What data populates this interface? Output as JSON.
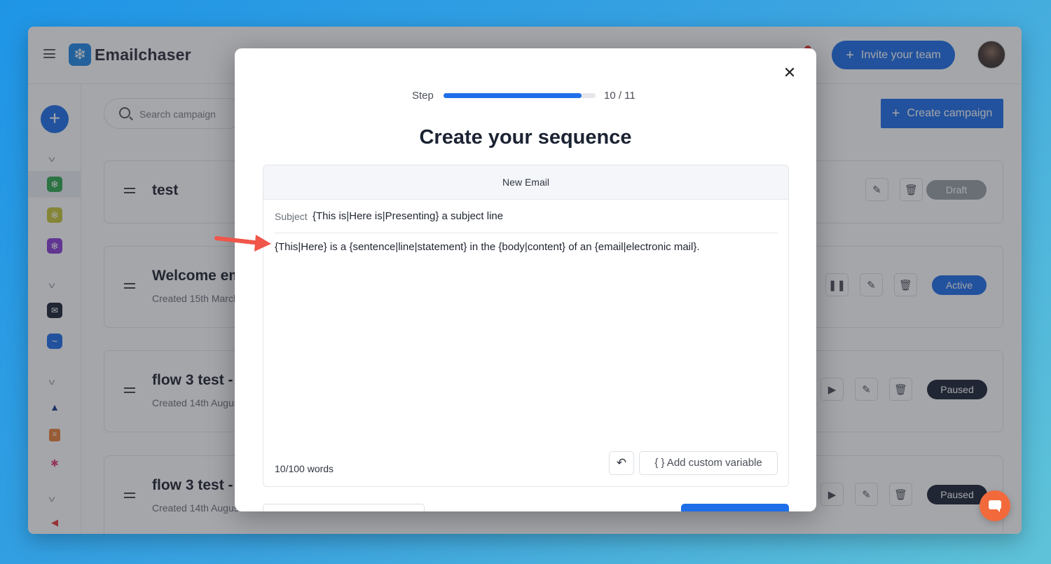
{
  "app": {
    "name": "Emailchaser",
    "invite_label": "Invite your team"
  },
  "main": {
    "search_placeholder": "Search campaign",
    "create_label": "Create campaign",
    "campaigns": [
      {
        "title": "test",
        "subtitle": "",
        "status": "Draft"
      },
      {
        "title": "Welcome em",
        "subtitle": "Created 15th March",
        "status": "Active"
      },
      {
        "title": "flow 3 test -",
        "subtitle": "Created 14th August",
        "status": "Paused"
      },
      {
        "title": "flow 3 test -",
        "subtitle": "Created 14th August",
        "status": "Paused"
      }
    ]
  },
  "modal": {
    "step_label": "Step",
    "step_progress": 0.909,
    "step_count": "10 / 11",
    "title": "Create your sequence",
    "email_header": "New Email",
    "subject_label": "Subject",
    "subject_value": "{This is|Here is|Presenting} a subject line",
    "body_value": "{This|Here} is a {sentence|line|statement} in the {body|content} of an {email|electronic mail}.",
    "word_count": "10/100 words",
    "add_variable_label": "{ } Add custom variable"
  },
  "colors": {
    "primary": "#1e6fe8",
    "draft": "#9aa0a6",
    "active": "#1e6fe8",
    "paused": "#1b2333",
    "annotation_arrow": "#f0564a",
    "chat": "#f26a3b"
  },
  "icons": [
    "menu-icon",
    "logo-icon",
    "plus-icon",
    "search-icon",
    "drag-handle-icon",
    "edit-icon",
    "trash-icon",
    "pause-icon",
    "play-icon",
    "close-icon",
    "undo-icon",
    "chat-icon",
    "arrow-annotation"
  ]
}
